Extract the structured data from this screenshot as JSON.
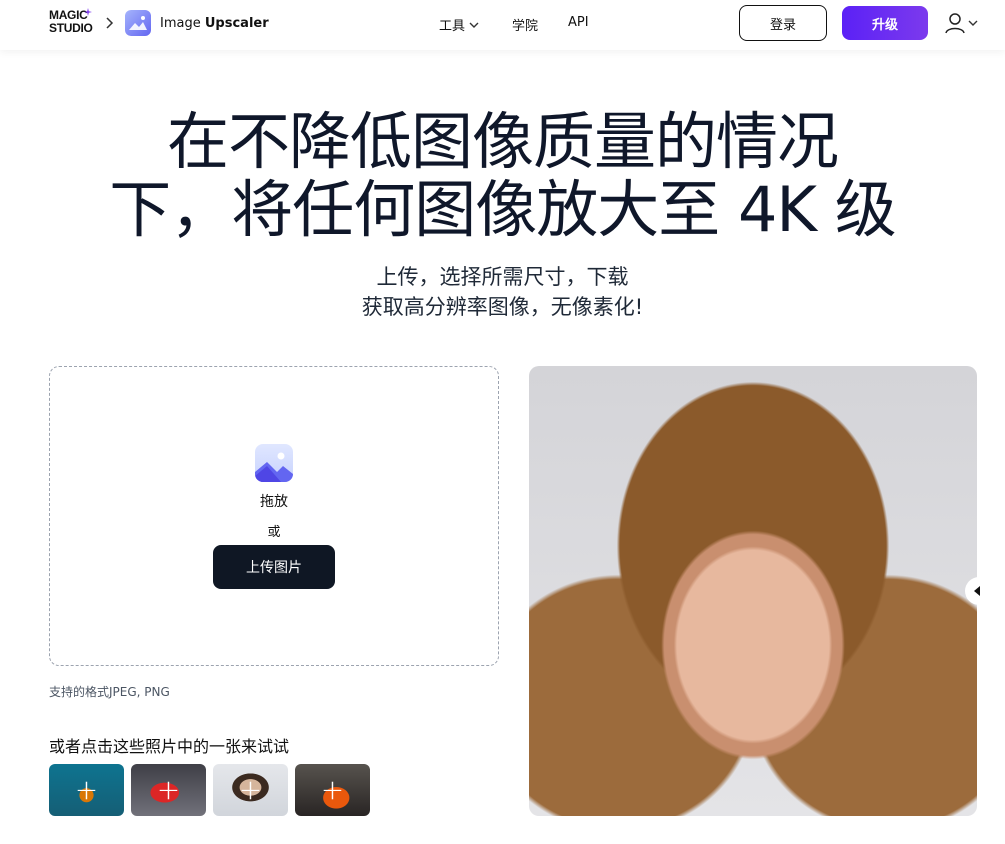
{
  "header": {
    "logo_line1": "MAGIC",
    "logo_line2": "STUDIO",
    "app_name_regular": "Image ",
    "app_name_bold": "Upscaler",
    "nav": {
      "tools": "工具",
      "academy": "学院",
      "api": "API"
    },
    "login": "登录",
    "upgrade": "升级",
    "accent_color": "#5b21f6"
  },
  "hero": {
    "title_line1": "在不降低图像质量的情况",
    "title_line2": "下，将任何图像放大至 4K 级",
    "subtitle_line1": "上传，选择所需尺寸，下载",
    "subtitle_line2": "获取高分辨率图像，无像素化!"
  },
  "upload": {
    "drag_label": "拖放",
    "or_label": "或",
    "button_label": "上传图片",
    "formats": "支持的格式JPEG, PNG"
  },
  "samples": {
    "label": "或者点击这些照片中的一张来试试",
    "items": [
      {
        "icon": "plus-icon"
      },
      {
        "icon": "plus-icon"
      },
      {
        "icon": "plus-icon"
      },
      {
        "icon": "plus-icon"
      }
    ]
  },
  "preview": {
    "icon": "compare-slider-handle-icon"
  }
}
